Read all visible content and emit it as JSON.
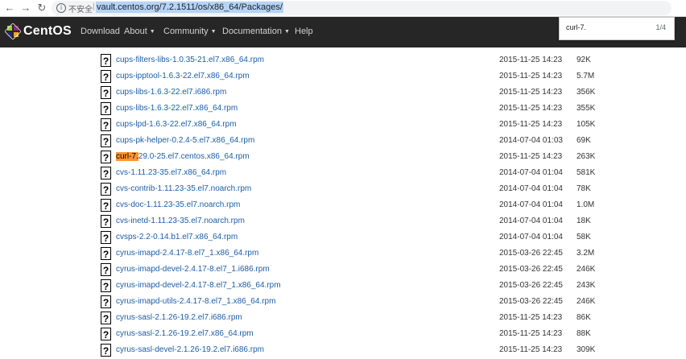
{
  "browser": {
    "insecure_label": "不安全",
    "separator": "|",
    "url": "vault.centos.org/7.2.1511/os/x86_64/Packages/"
  },
  "navbar": {
    "brand": "CentOS",
    "items": [
      {
        "label": "Download"
      },
      {
        "label": "About"
      },
      {
        "label": "Community"
      },
      {
        "label": "Documentation"
      },
      {
        "label": "Help"
      }
    ]
  },
  "findbar": {
    "query": "curl-7.",
    "count": "1/4"
  },
  "files": [
    {
      "name": "cups-filters-libs-1.0.35-21.el7.x86_64.rpm",
      "date": "2015-11-25 14:23",
      "size": "92K"
    },
    {
      "name": "cups-ipptool-1.6.3-22.el7.x86_64.rpm",
      "date": "2015-11-25 14:23",
      "size": "5.7M"
    },
    {
      "name": "cups-libs-1.6.3-22.el7.i686.rpm",
      "date": "2015-11-25 14:23",
      "size": "356K"
    },
    {
      "name": "cups-libs-1.6.3-22.el7.x86_64.rpm",
      "date": "2015-11-25 14:23",
      "size": "355K"
    },
    {
      "name": "cups-lpd-1.6.3-22.el7.x86_64.rpm",
      "date": "2015-11-25 14:23",
      "size": "105K"
    },
    {
      "name": "cups-pk-helper-0.2.4-5.el7.x86_64.rpm",
      "date": "2014-07-04 01:03",
      "size": "69K"
    },
    {
      "name": "curl-7.29.0-25.el7.centos.x86_64.rpm",
      "date": "2015-11-25 14:23",
      "size": "263K",
      "highlight": "curl-7.",
      "rest": "29.0-25.el7.centos.x86_64.rpm"
    },
    {
      "name": "cvs-1.11.23-35.el7.x86_64.rpm",
      "date": "2014-07-04 01:04",
      "size": "581K"
    },
    {
      "name": "cvs-contrib-1.11.23-35.el7.noarch.rpm",
      "date": "2014-07-04 01:04",
      "size": "78K"
    },
    {
      "name": "cvs-doc-1.11.23-35.el7.noarch.rpm",
      "date": "2014-07-04 01:04",
      "size": "1.0M"
    },
    {
      "name": "cvs-inetd-1.11.23-35.el7.noarch.rpm",
      "date": "2014-07-04 01:04",
      "size": "18K"
    },
    {
      "name": "cvsps-2.2-0.14.b1.el7.x86_64.rpm",
      "date": "2014-07-04 01:04",
      "size": "58K"
    },
    {
      "name": "cyrus-imapd-2.4.17-8.el7_1.x86_64.rpm",
      "date": "2015-03-26 22:45",
      "size": "3.2M"
    },
    {
      "name": "cyrus-imapd-devel-2.4.17-8.el7_1.i686.rpm",
      "date": "2015-03-26 22:45",
      "size": "246K"
    },
    {
      "name": "cyrus-imapd-devel-2.4.17-8.el7_1.x86_64.rpm",
      "date": "2015-03-26 22:45",
      "size": "243K"
    },
    {
      "name": "cyrus-imapd-utils-2.4.17-8.el7_1.x86_64.rpm",
      "date": "2015-03-26 22:45",
      "size": "246K"
    },
    {
      "name": "cyrus-sasl-2.1.26-19.2.el7.i686.rpm",
      "date": "2015-11-25 14:23",
      "size": "86K"
    },
    {
      "name": "cyrus-sasl-2.1.26-19.2.el7.x86_64.rpm",
      "date": "2015-11-25 14:23",
      "size": "88K"
    },
    {
      "name": "cyrus-sasl-devel-2.1.26-19.2.el7.i686.rpm",
      "date": "2015-11-25 14:23",
      "size": "309K"
    }
  ],
  "colors": {
    "link": "#1a5ea8",
    "navbar_bg": "#262626",
    "find_highlight": "#ff9632"
  },
  "icons": {
    "file": "unknown-file-icon"
  }
}
